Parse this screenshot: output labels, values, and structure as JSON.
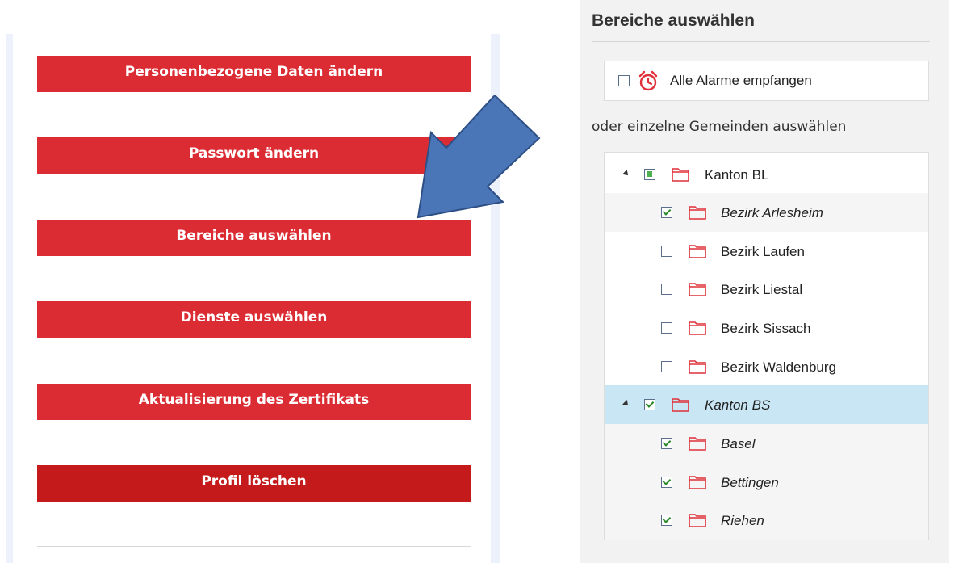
{
  "left_menu": {
    "buttons": [
      {
        "label": "Personenbezogene Daten ändern"
      },
      {
        "label": "Passwort ändern"
      },
      {
        "label": "Bereiche auswählen"
      },
      {
        "label": "Dienste auswählen"
      },
      {
        "label": "Aktualisierung des Zertifikats"
      },
      {
        "label": "Profil löschen"
      }
    ]
  },
  "right_panel": {
    "title": "Bereiche auswählen",
    "all_alarms_label": "Alle Alarme empfangen",
    "all_alarms_checked": false,
    "or_text": "oder einzelne Gemeinden auswählen",
    "tree": [
      {
        "label": "Kanton BL",
        "level": 0,
        "state": "partial",
        "italic": false,
        "expanded": true
      },
      {
        "label": "Bezirk Arlesheim",
        "level": 1,
        "state": "checked",
        "italic": true
      },
      {
        "label": "Bezirk Laufen",
        "level": 1,
        "state": "unchecked",
        "italic": false
      },
      {
        "label": "Bezirk Liestal",
        "level": 1,
        "state": "unchecked",
        "italic": false
      },
      {
        "label": "Bezirk Sissach",
        "level": 1,
        "state": "unchecked",
        "italic": false
      },
      {
        "label": "Bezirk Waldenburg",
        "level": 1,
        "state": "unchecked",
        "italic": false
      },
      {
        "label": "Kanton BS",
        "level": 0,
        "state": "checked",
        "italic": true,
        "expanded": true,
        "selected": true
      },
      {
        "label": "Basel",
        "level": 1,
        "state": "checked",
        "italic": true
      },
      {
        "label": "Bettingen",
        "level": 1,
        "state": "checked",
        "italic": true
      },
      {
        "label": "Riehen",
        "level": 1,
        "state": "checked",
        "italic": true
      }
    ]
  },
  "colors": {
    "button_red": "#dc2c33",
    "button_dark_red": "#c41a1b",
    "arrow_fill": "#4a76b8",
    "selected_row": "#c9e6f4",
    "icon_red": "#e0303a"
  },
  "icons": {
    "alarm": "alarm-clock-icon",
    "folder": "folder-icon",
    "arrow": "pointing-arrow"
  }
}
